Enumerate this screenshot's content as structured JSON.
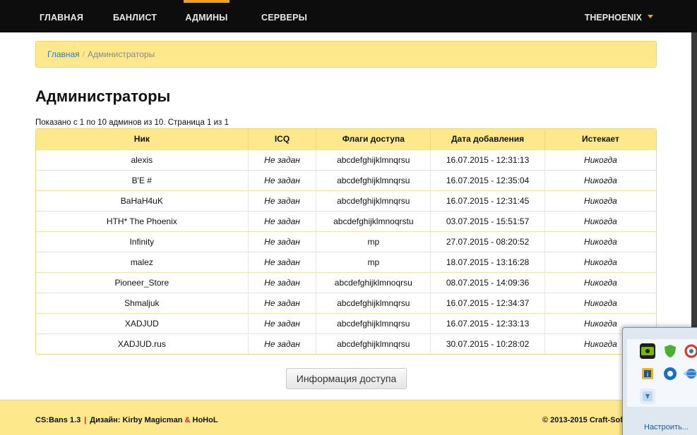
{
  "nav": {
    "items": [
      {
        "label": "Главная",
        "active": false
      },
      {
        "label": "Банлист",
        "active": false
      },
      {
        "label": "Админы",
        "active": true
      },
      {
        "label": "Серверы",
        "active": false
      }
    ],
    "user": "THEPHOENIX"
  },
  "breadcrumb": {
    "home": "Главная",
    "separator": "/",
    "current": "Администраторы"
  },
  "page": {
    "title": "Администраторы",
    "summary": "Показано с 1 по 10 админов из 10. Страница 1 из 1"
  },
  "table": {
    "headers": [
      "Ник",
      "ICQ",
      "Флаги доступа",
      "Дата добавления",
      "Истекает"
    ],
    "rows": [
      [
        "alexis",
        "Не задан",
        "abcdefghijklmnqrsu",
        "16.07.2015 - 12:31:13",
        "Никогда"
      ],
      [
        "B'E #",
        "Не задан",
        "abcdefghijklmnqrsu",
        "16.07.2015 - 12:35:04",
        "Никогда"
      ],
      [
        "BaHaH4uK",
        "Не задан",
        "abcdefghijklmnqrsu",
        "16.07.2015 - 12:31:45",
        "Никогда"
      ],
      [
        "HTH* The Phoenix",
        "Не задан",
        "abcdefghijklmnoqrstu",
        "03.07.2015 - 15:51:57",
        "Никогда"
      ],
      [
        "Infinity",
        "Не задан",
        "mp",
        "27.07.2015 - 08:20:52",
        "Никогда"
      ],
      [
        "malez",
        "Не задан",
        "mp",
        "18.07.2015 - 13:16:28",
        "Никогда"
      ],
      [
        "Pioneer_Store",
        "Не задан",
        "abcdefghijklmnoqrsu",
        "08.07.2015 - 14:09:36",
        "Никогда"
      ],
      [
        "Shmaljuk",
        "Не задан",
        "abcdefghijklmnqrsu",
        "16.07.2015 - 12:34:37",
        "Никогда"
      ],
      [
        "XADJUD",
        "Не задан",
        "abcdefghijklmnqrsu",
        "16.07.2015 - 12:33:13",
        "Никогда"
      ],
      [
        "XADJUD.rus",
        "Не задан",
        "abcdefghijklmnqrsu",
        "30.07.2015 - 10:28:02",
        "Никогда"
      ]
    ]
  },
  "info_button": "Информация доступа",
  "footer": {
    "app": "CS:Bans 1.3",
    "pipe": "|",
    "design_prefix": "Дизайн: Kirby Magicman",
    "amp": "&",
    "design_suffix": "HoHoL",
    "copyright": "© 2013-2015 Craft-Sof"
  },
  "tray": {
    "link": "Настроить...",
    "icons": [
      "nvidia-icon",
      "shield-icon",
      "recycle-icon",
      "info-icon",
      "g-icon",
      "globe-icon",
      "app-icon"
    ]
  },
  "colors": {
    "accent": "#f0a020",
    "breadcrumb_bg": "#fde98c",
    "navbar_bg": "#0d0d0d",
    "link": "#2a7fc4"
  }
}
